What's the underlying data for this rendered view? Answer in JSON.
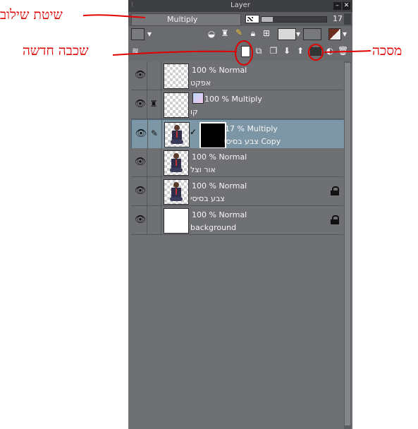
{
  "panel": {
    "title": "Layer",
    "blend_mode": "Multiply",
    "opacity_value": "17",
    "opacity_fraction": 0.17
  },
  "annotations": {
    "blend_mode_label": "שיטת שילוב",
    "new_layer_label": "שכבה חדשה",
    "mask_label": "מסכה"
  },
  "layers": [
    {
      "top": "100 % Normal",
      "bottom": "אפקט"
    },
    {
      "top": "100 % Multiply",
      "bottom": "קו"
    },
    {
      "top": "17 % Multiply",
      "bottom": "צבע בסיסי Copy"
    },
    {
      "top": "100 % Normal",
      "bottom": "אור וצל"
    },
    {
      "top": "100 % Normal",
      "bottom": "צבע בסיסי"
    },
    {
      "top": "100 % Normal",
      "bottom": "background"
    }
  ],
  "colors": {
    "accent_annotation": "#e00000",
    "selected_layer": "#7d96a5"
  }
}
